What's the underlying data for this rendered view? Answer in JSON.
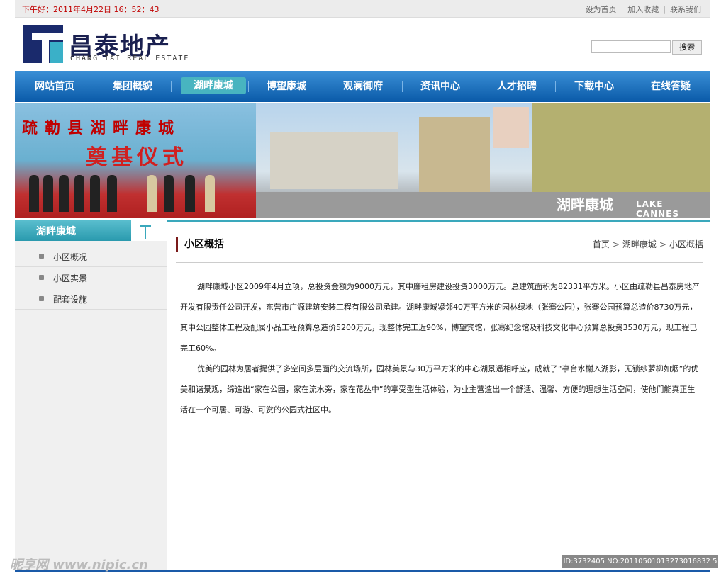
{
  "topbar": {
    "greeting": "下午好：2011年4月22日 16：52：43",
    "links": [
      "设为首页",
      "加入收藏",
      "联系我们"
    ]
  },
  "header": {
    "logo_cn": "昌泰地产",
    "logo_en": "CHANG TAI REAL ESTATE",
    "search_placeholder": "",
    "search_button": "搜索"
  },
  "nav": {
    "items": [
      "网站首页",
      "集团概貌",
      "湖畔康城",
      "博望康城",
      "观澜御府",
      "资讯中心",
      "人才招聘",
      "下载中心",
      "在线答疑"
    ],
    "active_index": 2
  },
  "banner": {
    "title_line1": "疏勒县湖畔康城",
    "title_line2": "奠基仪式",
    "brand_cn": "湖畔康城",
    "brand_en": "LAKE CANNES"
  },
  "sidebar": {
    "title": "湖畔康城",
    "items": [
      "小区概况",
      "小区实景",
      "配套设施"
    ]
  },
  "content": {
    "title": "小区概括",
    "breadcrumb": [
      "首页",
      "湖畔康城",
      "小区概括"
    ],
    "paragraphs": [
      "湖畔康城小区2009年4月立项，总投资金额为9000万元，其中廉租房建设投资3000万元。总建筑面积为82331平方米。小区由疏勒县昌泰房地产开发有限责任公司开发，东营市广源建筑安装工程有限公司承建。湖畔康城紧邻40万平方米的园林绿地（张骞公园），张骞公园预算总造价8730万元，其中公园整体工程及配属小品工程预算总造价5200万元，现整体完工近90%，博望宾馆，张骞纪念馆及科技文化中心预算总投资3530万元，现工程已完工60%。",
      "优美的园林为居者提供了多空间多层面的交流场所，园林美景与30万平方米的中心湖景遥相呼应，成就了“亭台水榭入湖影，无锁纱萝柳如烟”的优美和谐景观，缔造出“家在公园，家在流水旁，家在花丛中”的享受型生活体验，为业主营造出一个舒适、温馨、方便的理想生活空间，使他们能真正生活在一个可居、可游、可赏的公园式社区中。"
    ]
  },
  "watermark": {
    "site": "昵享网 www.nipic.cn",
    "id": "ID:3732405 NO:20110501013273016832 5"
  },
  "colors": {
    "nav_blue": "#0a5aa8",
    "accent_teal": "#3aa8bc",
    "greeting_red": "#c00000"
  }
}
